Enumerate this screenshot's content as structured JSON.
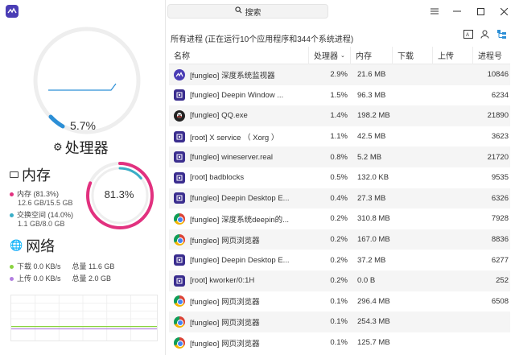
{
  "app": {
    "logo_icon": "deepin-monitor-icon"
  },
  "colors": {
    "cpu_accent": "#2c8fd6",
    "mem_pink": "#e2317f",
    "swap_teal": "#3aaec7",
    "dl_green": "#8ad340",
    "ul_purple": "#b27ee0",
    "ring_track": "#eeeeee"
  },
  "cpu": {
    "percent": "5.7%",
    "fraction": 0.057,
    "title": "处理器"
  },
  "memory": {
    "title": "内存",
    "percent": "81.3%",
    "fraction": 0.813,
    "swap_fraction": 0.14,
    "mem_label": "内存 (81.3%)",
    "mem_detail": "12.6 GB/15.5 GB",
    "swap_label": "交换空间 (14.0%)",
    "swap_detail": "1.1 GB/8.0 GB"
  },
  "network": {
    "title": "网络",
    "download_label": "下载 0.0 KB/s",
    "download_total": "总量 11.6 GB",
    "upload_label": "上传 0.0 KB/s",
    "upload_total": "总量 2.0 GB"
  },
  "search": {
    "placeholder": "搜索"
  },
  "process_summary": "所有进程 (正在运行10个应用程序和344个系统进程)",
  "table": {
    "headers": {
      "name": "名称",
      "cpu": "处理器",
      "mem": "内存",
      "download": "下载",
      "upload": "上传",
      "pid": "进程号"
    },
    "rows": [
      {
        "icon": "monitor",
        "name": "[fungleo] 深度系统监视器",
        "cpu": "2.9%",
        "mem": "21.6 MB",
        "pid": "10846"
      },
      {
        "icon": "deepin",
        "name": "[fungleo] Deepin Window ...",
        "cpu": "1.5%",
        "mem": "96.3 MB",
        "pid": "6234"
      },
      {
        "icon": "qq",
        "name": "[fungleo] QQ.exe",
        "cpu": "1.4%",
        "mem": "198.2 MB",
        "pid": "21890"
      },
      {
        "icon": "deepin",
        "name": "[root] X service （ Xorg ）",
        "cpu": "1.1%",
        "mem": "42.5 MB",
        "pid": "3623"
      },
      {
        "icon": "deepin",
        "name": "[fungleo] wineserver.real",
        "cpu": "0.8%",
        "mem": "5.2 MB",
        "pid": "21720"
      },
      {
        "icon": "deepin",
        "name": "[root] badblocks",
        "cpu": "0.5%",
        "mem": "132.0 KB",
        "pid": "9535"
      },
      {
        "icon": "deepin",
        "name": "[fungleo] Deepin Desktop E...",
        "cpu": "0.4%",
        "mem": "27.3 MB",
        "pid": "6326"
      },
      {
        "icon": "chrome",
        "name": "[fungleo] 深度系统deepin的...",
        "cpu": "0.2%",
        "mem": "310.8 MB",
        "pid": "7928"
      },
      {
        "icon": "chrome",
        "name": "[fungleo] 网页浏览器",
        "cpu": "0.2%",
        "mem": "167.0 MB",
        "pid": "8836"
      },
      {
        "icon": "deepin",
        "name": "[fungleo] Deepin Desktop E...",
        "cpu": "0.2%",
        "mem": "37.2 MB",
        "pid": "6277"
      },
      {
        "icon": "deepin",
        "name": "[root] kworker/0:1H",
        "cpu": "0.2%",
        "mem": "0.0 B",
        "pid": "252"
      },
      {
        "icon": "chrome",
        "name": "[fungleo] 网页浏览器",
        "cpu": "0.1%",
        "mem": "296.4 MB",
        "pid": "6508"
      },
      {
        "icon": "chrome",
        "name": "[fungleo] 网页浏览器",
        "cpu": "0.1%",
        "mem": "254.3 MB",
        "pid": ""
      },
      {
        "icon": "chrome",
        "name": "[fungleo] 网页浏览器",
        "cpu": "0.1%",
        "mem": "125.7 MB",
        "pid": ""
      }
    ]
  }
}
